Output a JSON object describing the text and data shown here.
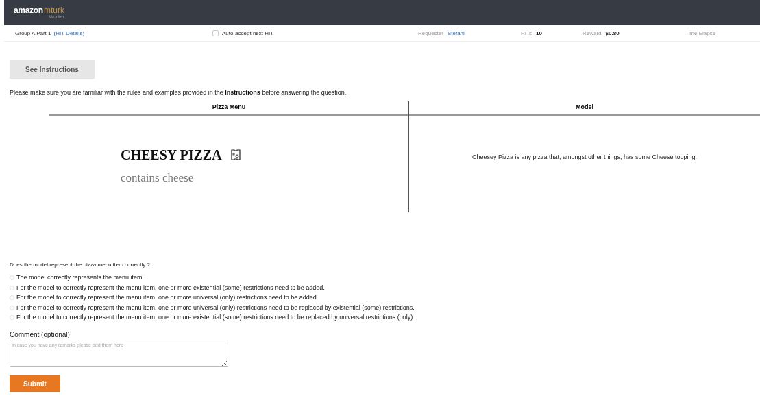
{
  "logo": {
    "brand": "amazon",
    "product": "mturk",
    "subtitle": "Worker"
  },
  "hit_bar": {
    "title": "Group A Part 1",
    "details_link": "(HIT Details)",
    "auto_accept": {
      "label": "Auto-accept next HIT",
      "checked": false
    },
    "stats": [
      {
        "label": "Requester",
        "value": "Stefani",
        "kind": "link"
      },
      {
        "label": "HITs",
        "value": "10",
        "kind": "plain"
      },
      {
        "label": "Reward",
        "value": "$0.80",
        "kind": "plain"
      },
      {
        "label": "Time Elapse",
        "kind": "label"
      }
    ]
  },
  "instructions_button": "See Instructions",
  "notice": "Please make sure you are familiar with the rules and examples provided in the **Instructions** before answering the question.",
  "table": {
    "columns": [
      "Pizza Menu",
      "Model"
    ],
    "menu_item": {
      "name": "CHEESY PIZZA",
      "description": "contains cheese"
    },
    "model_text": "Cheesey Pizza is any pizza that, amongst other things, has some Cheese topping."
  },
  "question": "Does the model represent the pizza menu item correctly ?",
  "options": [
    {
      "label": "The model correctly represents the menu item.",
      "selected": false
    },
    {
      "label": "For the model to correctly represent the menu item, one or more existential (some) restrictions need to be added.",
      "selected": false
    },
    {
      "label": "For the model to correctly represent the menu item, one or more universal (only) restrictions need to be added.",
      "selected": false
    },
    {
      "label": "For the model to correctly represent the menu item, one or more universal (only) restrictions need to be replaced by existential (some) restrictions.",
      "selected": false
    },
    {
      "label": "For the model to correctly represent the menu item, one or more existential (some) restrictions need to be replaced by universal restrictions (only).",
      "selected": false
    }
  ],
  "comment": {
    "label": "Comment (optional)",
    "placeholder": "In case you have any remarks please add them here"
  },
  "submit_button": "Submit"
}
